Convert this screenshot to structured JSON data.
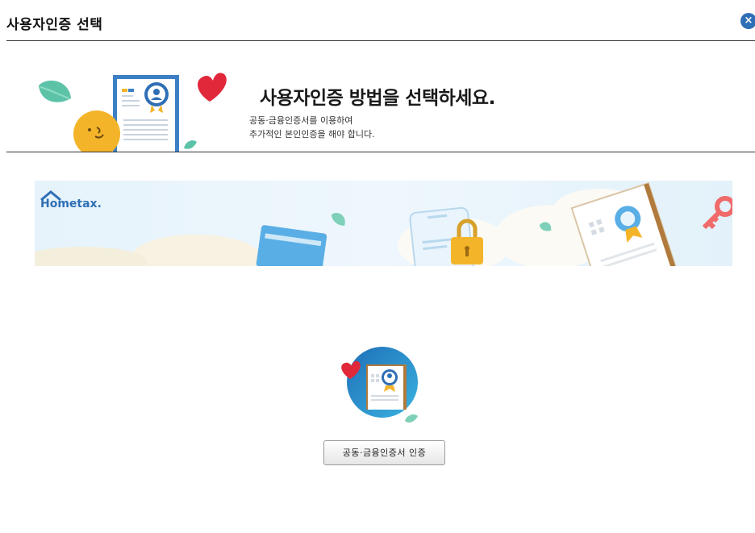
{
  "dialog": {
    "title": "사용자인증 선택",
    "close_label": "×"
  },
  "hero": {
    "heading": "사용자인증 방법을 선택하세요.",
    "desc_line1": "공동·금융인증서를 이용하여",
    "desc_line2": "추가적인 본인인증을 해야 합니다."
  },
  "banner": {
    "logo_text": "Hometax."
  },
  "method": {
    "button_label": "공동·금융인증서 인증"
  },
  "colors": {
    "accent": "#2f6fb5",
    "heart": "#e0283a",
    "leaf": "#5cc3a8",
    "smiley": "#f4b42a"
  }
}
